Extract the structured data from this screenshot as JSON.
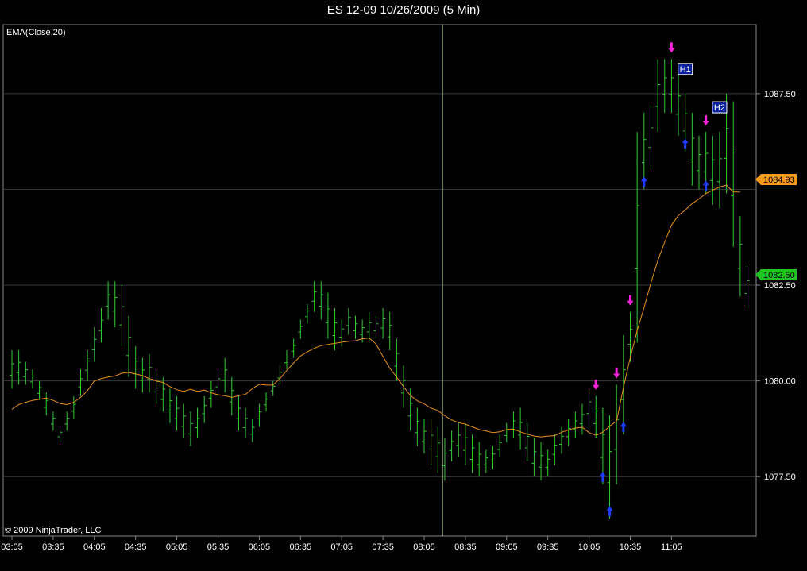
{
  "title": "ES 12-09  10/26/2009 (5 Min)",
  "indicator_label": "EMA(Close,20)",
  "copyright": "© 2009 NinjaTrader, LLC",
  "colors": {
    "background": "#000000",
    "bars": "#33cc33",
    "ema": "#e8901c",
    "grid": "#3a3a3a",
    "crosshair": "#d8f0c8",
    "up_arrow": "#1f3cff",
    "down_arrow": "#ff22dd",
    "ema_tag": "#f59a1b",
    "price_tag": "#22c422"
  },
  "chart_data": {
    "type": "ohlc",
    "title": "ES 12-09  10/26/2009 (5 Min)",
    "ylim": [
      1075.95,
      1089.3
    ],
    "y_ticks": [
      1077.5,
      1080.0,
      1082.5,
      1087.5
    ],
    "y_tick_labels": [
      "1077.50",
      "1080.00",
      "1082.50",
      "1087.50"
    ],
    "x_tick_labels": [
      "03:05",
      "03:35",
      "04:05",
      "04:35",
      "05:05",
      "05:35",
      "06:05",
      "06:35",
      "07:05",
      "07:35",
      "08:05",
      "08:35",
      "09:05",
      "09:35",
      "10:05",
      "10:35",
      "11:05"
    ],
    "bar_count": 107,
    "bars_per_tick": 6,
    "series": [
      {
        "name": "EMA(Close,20)",
        "last_value_label": "1084.93"
      }
    ],
    "last_price_label": "1082.50",
    "highs": [
      1080.8,
      1080.8,
      1080.5,
      1080.3,
      1080.0,
      1079.7,
      1079.2,
      1078.8,
      1079.2,
      1079.6,
      1080.3,
      1080.8,
      1081.4,
      1081.9,
      1082.6,
      1082.6,
      1082.5,
      1081.7,
      1080.9,
      1080.6,
      1080.7,
      1080.3,
      1080.1,
      1079.8,
      1079.6,
      1079.4,
      1079.2,
      1079.3,
      1079.6,
      1080.0,
      1080.3,
      1080.6,
      1080.1,
      1079.6,
      1079.3,
      1079.0,
      1079.4,
      1079.7,
      1080.0,
      1080.4,
      1080.8,
      1081.1,
      1081.6,
      1082.0,
      1082.6,
      1082.6,
      1082.3,
      1081.9,
      1081.6,
      1081.9,
      1081.7,
      1081.6,
      1081.8,
      1081.7,
      1081.9,
      1081.8,
      1081.1,
      1080.4,
      1079.8,
      1079.3,
      1079.0,
      1079.0,
      1078.8,
      1078.5,
      1078.7,
      1078.9,
      1078.9,
      1078.6,
      1078.4,
      1078.2,
      1078.3,
      1078.6,
      1078.9,
      1079.2,
      1079.3,
      1078.9,
      1078.5,
      1078.4,
      1078.2,
      1078.6,
      1078.8,
      1079.0,
      1079.2,
      1079.4,
      1079.8,
      1079.6,
      1079.3,
      1079.1,
      1079.9,
      1081.2,
      1081.8,
      1086.5,
      1087.0,
      1087.2,
      1088.4,
      1088.4,
      1088.4,
      1088.0,
      1087.5,
      1087.0,
      1086.4,
      1086.5,
      1086.4,
      1086.5,
      1087.5,
      1087.3,
      1084.3,
      1083.0
    ],
    "lows": [
      1079.8,
      1079.9,
      1079.9,
      1079.8,
      1079.5,
      1079.1,
      1078.7,
      1078.4,
      1078.7,
      1079.0,
      1079.6,
      1080.0,
      1080.5,
      1081.0,
      1081.6,
      1081.4,
      1080.9,
      1080.1,
      1079.8,
      1079.7,
      1079.7,
      1079.4,
      1079.2,
      1078.9,
      1078.7,
      1078.5,
      1078.3,
      1078.5,
      1078.9,
      1079.3,
      1079.6,
      1079.7,
      1079.1,
      1078.7,
      1078.5,
      1078.4,
      1078.8,
      1079.2,
      1079.6,
      1079.9,
      1080.3,
      1080.6,
      1081.1,
      1081.5,
      1081.8,
      1081.6,
      1081.1,
      1080.8,
      1080.9,
      1081.2,
      1081.1,
      1081.0,
      1081.0,
      1081.1,
      1081.1,
      1080.8,
      1080.0,
      1079.3,
      1078.7,
      1078.3,
      1078.1,
      1077.8,
      1077.6,
      1077.4,
      1077.9,
      1078.0,
      1077.8,
      1077.6,
      1077.5,
      1077.6,
      1077.7,
      1078.0,
      1078.4,
      1078.5,
      1078.2,
      1077.9,
      1077.5,
      1077.4,
      1077.5,
      1077.8,
      1078.1,
      1078.3,
      1078.5,
      1078.6,
      1078.8,
      1078.5,
      1077.3,
      1076.4,
      1077.3,
      1078.6,
      1080.5,
      1081.0,
      1085.0,
      1085.5,
      1086.5,
      1087.0,
      1087.0,
      1086.4,
      1086.0,
      1085.1,
      1085.0,
      1084.9,
      1084.6,
      1084.5,
      1084.9,
      1083.5,
      1082.2,
      1081.9
    ],
    "ema": [
      1079.26,
      1079.38,
      1079.44,
      1079.49,
      1079.52,
      1079.55,
      1079.49,
      1079.41,
      1079.38,
      1079.44,
      1079.57,
      1079.75,
      1080.0,
      1080.06,
      1080.1,
      1080.13,
      1080.2,
      1080.22,
      1080.18,
      1080.14,
      1080.06,
      1080.0,
      1079.96,
      1079.85,
      1079.77,
      1079.73,
      1079.78,
      1079.73,
      1079.76,
      1079.69,
      1079.64,
      1079.61,
      1079.57,
      1079.61,
      1079.65,
      1079.8,
      1079.91,
      1079.89,
      1079.89,
      1080.06,
      1080.27,
      1080.47,
      1080.65,
      1080.76,
      1080.85,
      1080.92,
      1080.95,
      1080.98,
      1081.01,
      1081.03,
      1081.05,
      1081.1,
      1081.12,
      1080.96,
      1080.64,
      1080.33,
      1080.1,
      1079.85,
      1079.62,
      1079.48,
      1079.4,
      1079.29,
      1079.23,
      1079.09,
      1078.98,
      1078.91,
      1078.87,
      1078.8,
      1078.73,
      1078.69,
      1078.65,
      1078.67,
      1078.73,
      1078.74,
      1078.67,
      1078.61,
      1078.56,
      1078.54,
      1078.56,
      1078.57,
      1078.66,
      1078.72,
      1078.77,
      1078.79,
      1078.65,
      1078.58,
      1078.66,
      1078.82,
      1078.95,
      1079.83,
      1080.61,
      1081.31,
      1081.91,
      1082.56,
      1083.14,
      1083.62,
      1084.07,
      1084.32,
      1084.46,
      1084.63,
      1084.75,
      1084.89,
      1084.98,
      1085.06,
      1085.11,
      1084.93,
      1084.93
    ],
    "up_arrow_bars": [
      86,
      87,
      89,
      92,
      98,
      101
    ],
    "down_arrow_bars": [
      85,
      88,
      90,
      96,
      101
    ],
    "labels": [
      {
        "text": "H1",
        "bar": 98
      },
      {
        "text": "H2",
        "bar": 103
      }
    ]
  }
}
